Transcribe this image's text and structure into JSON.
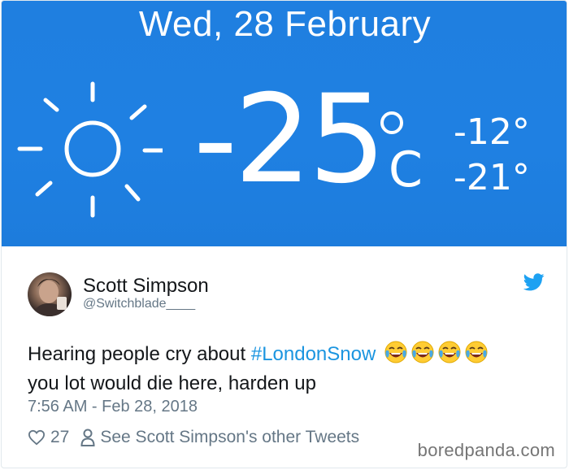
{
  "weather": {
    "date": "Wed, 28 February",
    "temperature": "-25",
    "unit": "C",
    "high": "-12°",
    "low": "-21°",
    "icon": "sun-icon"
  },
  "tweet": {
    "author_name": "Scott Simpson",
    "author_handle": "@Switchblade____",
    "text_before": "Hearing people cry about ",
    "hashtag": "#LondonSnow",
    "text_after": "you lot would die here, harden up",
    "emoji_name": "face-with-tears-of-joy",
    "emoji_count": 4,
    "timestamp": "7:56 AM - Feb 28, 2018",
    "likes": "27",
    "other_tweets_label": "See Scott Simpson's other Tweets",
    "brand_icon": "twitter-bird-icon"
  },
  "watermark": "boredpanda.com",
  "colors": {
    "weather_bg": "#1f80e2",
    "hashtag": "#1b95e0",
    "twitter_blue": "#1da1f2",
    "muted": "#657786"
  }
}
